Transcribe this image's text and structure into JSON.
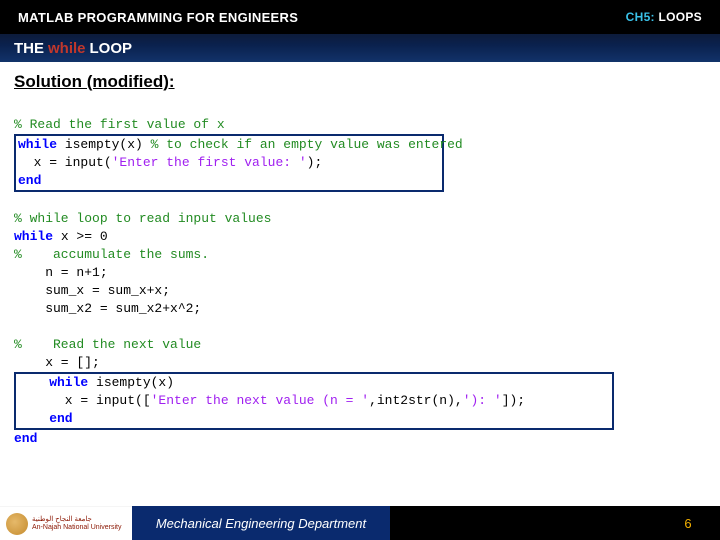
{
  "topbar": {
    "course": "MATLAB PROGRAMMING FOR ENGINEERS",
    "chapter_label": "CH5:",
    "chapter_title": "LOOPS"
  },
  "title": {
    "pre": "THE",
    "while": "while",
    "post": "LOOP"
  },
  "solution_heading": "Solution (modified):",
  "code": {
    "l1_comment": "% Read the first value of x",
    "l2_kw": "while",
    "l2_rest": " isempty(x) ",
    "l2_comment": "% to check if an empty value was entered",
    "l3_pre": "  x = input(",
    "l3_str": "'Enter the first value: '",
    "l3_post": ");",
    "l4_kw": "end",
    "l6_comment": "% while loop to read input values",
    "l7_kw": "while",
    "l7_rest": " x >= 0",
    "l8_comment": "%    accumulate the sums.",
    "l9": "    n = n+1;",
    "l10": "    sum_x = sum_x+x;",
    "l11": "    sum_x2 = sum_x2+x^2;",
    "l13_comment": "%    Read the next value",
    "l14": "    x = [];",
    "l15_kw": "    while",
    "l15_rest": " isempty(x)",
    "l16_pre": "      x = input([",
    "l16_str": "'Enter the next value (n = '",
    "l16_mid": ",int2str(n),",
    "l16_str2": "'): '",
    "l16_post": "]);",
    "l17_kw": "    end",
    "l18_kw": "end"
  },
  "footer": {
    "uni_ar": "جامعة النجاح الوطنية",
    "uni_en": "An-Najah National University",
    "dept": "Mechanical Engineering Department",
    "page": "6"
  }
}
